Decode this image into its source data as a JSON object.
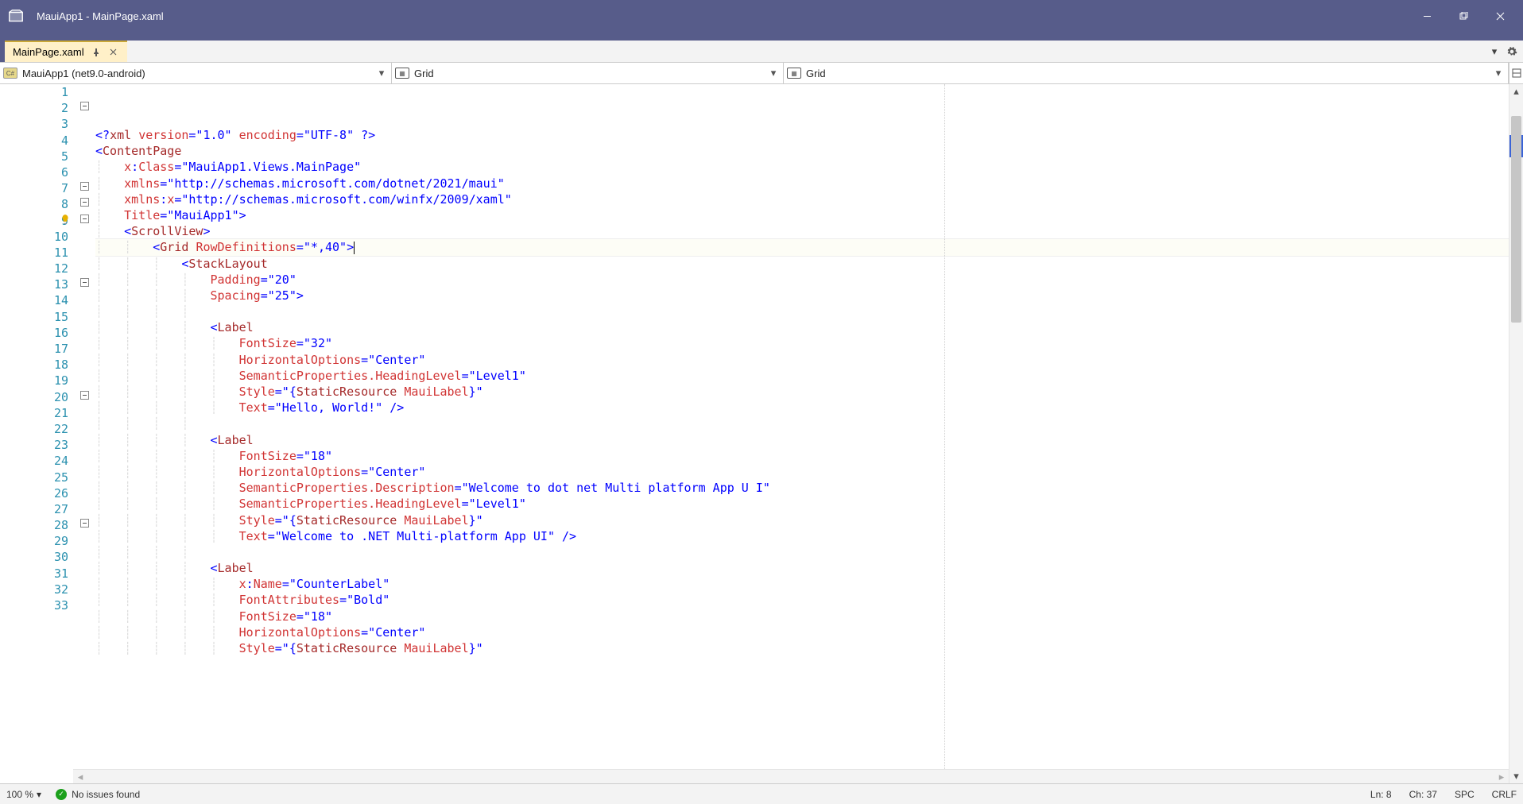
{
  "window": {
    "title": "MauiApp1 - MainPage.xaml"
  },
  "tab": {
    "name": "MainPage.xaml"
  },
  "nav": {
    "project": "MauiApp1 (net9.0-android)",
    "scope": "Grid",
    "element": "Grid"
  },
  "code": {
    "lines": [
      {
        "n": 1,
        "fold": "",
        "ind": 0,
        "segs": [
          {
            "c": "t-blue",
            "t": "<?"
          },
          {
            "c": "t-brown",
            "t": "xml "
          },
          {
            "c": "t-red",
            "t": "version"
          },
          {
            "c": "t-blue",
            "t": "=\"1.0\" "
          },
          {
            "c": "t-red",
            "t": "encoding"
          },
          {
            "c": "t-blue",
            "t": "=\"UTF-8\" ?>"
          }
        ]
      },
      {
        "n": 2,
        "fold": "m",
        "ind": 0,
        "segs": [
          {
            "c": "t-blue",
            "t": "<"
          },
          {
            "c": "t-brown",
            "t": "ContentPage"
          }
        ],
        "hlTag": true
      },
      {
        "n": 3,
        "fold": "",
        "ind": 1,
        "segs": [
          {
            "c": "t-red",
            "t": "x"
          },
          {
            "c": "t-blue",
            "t": ":"
          },
          {
            "c": "t-red",
            "t": "Class"
          },
          {
            "c": "t-blue",
            "t": "=\"MauiApp1.Views.MainPage\""
          }
        ]
      },
      {
        "n": 4,
        "fold": "",
        "ind": 1,
        "segs": [
          {
            "c": "t-red",
            "t": "xmlns"
          },
          {
            "c": "t-blue",
            "t": "=\"http://schemas.microsoft.com/dotnet/2021/maui\""
          }
        ]
      },
      {
        "n": 5,
        "fold": "",
        "ind": 1,
        "segs": [
          {
            "c": "t-red",
            "t": "xmlns"
          },
          {
            "c": "t-blue",
            "t": ":"
          },
          {
            "c": "t-red",
            "t": "x"
          },
          {
            "c": "t-blue",
            "t": "=\"http://schemas.microsoft.com/winfx/2009/xaml\""
          }
        ]
      },
      {
        "n": 6,
        "fold": "",
        "ind": 1,
        "segs": [
          {
            "c": "t-red",
            "t": "Title"
          },
          {
            "c": "t-blue",
            "t": "=\"MauiApp1\">"
          }
        ]
      },
      {
        "n": 7,
        "fold": "m",
        "ind": 1,
        "segs": [
          {
            "c": "t-blue",
            "t": "<"
          },
          {
            "c": "t-brown",
            "t": "ScrollView"
          },
          {
            "c": "t-blue",
            "t": ">"
          }
        ]
      },
      {
        "n": 8,
        "fold": "m",
        "ind": 2,
        "current": true,
        "bulb": true,
        "segs": [
          {
            "c": "t-blue",
            "t": "<"
          },
          {
            "c": "t-brown",
            "t": "Grid "
          },
          {
            "c": "t-red",
            "t": "RowDefinitions"
          },
          {
            "c": "t-blue",
            "t": "=\"*,40\">"
          }
        ],
        "cursor": true
      },
      {
        "n": 9,
        "fold": "m",
        "ind": 3,
        "segs": [
          {
            "c": "t-blue",
            "t": "<"
          },
          {
            "c": "t-brown",
            "t": "StackLayout"
          }
        ]
      },
      {
        "n": 10,
        "fold": "",
        "ind": 4,
        "segs": [
          {
            "c": "t-red",
            "t": "Padding"
          },
          {
            "c": "t-blue",
            "t": "=\"20\""
          }
        ]
      },
      {
        "n": 11,
        "fold": "",
        "ind": 4,
        "segs": [
          {
            "c": "t-red",
            "t": "Spacing"
          },
          {
            "c": "t-blue",
            "t": "=\"25\">"
          }
        ]
      },
      {
        "n": 12,
        "fold": "",
        "ind": 4,
        "segs": []
      },
      {
        "n": 13,
        "fold": "m",
        "ind": 4,
        "segs": [
          {
            "c": "t-blue",
            "t": "<"
          },
          {
            "c": "t-brown",
            "t": "Label"
          }
        ]
      },
      {
        "n": 14,
        "fold": "",
        "ind": 5,
        "segs": [
          {
            "c": "t-red",
            "t": "FontSize"
          },
          {
            "c": "t-blue",
            "t": "=\"32\""
          }
        ]
      },
      {
        "n": 15,
        "fold": "",
        "ind": 5,
        "segs": [
          {
            "c": "t-red",
            "t": "HorizontalOptions"
          },
          {
            "c": "t-blue",
            "t": "=\"Center\""
          }
        ]
      },
      {
        "n": 16,
        "fold": "",
        "ind": 5,
        "segs": [
          {
            "c": "t-red",
            "t": "SemanticProperties.HeadingLevel"
          },
          {
            "c": "t-blue",
            "t": "=\"Level1\""
          }
        ]
      },
      {
        "n": 17,
        "fold": "",
        "ind": 5,
        "segs": [
          {
            "c": "t-red",
            "t": "Style"
          },
          {
            "c": "t-blue",
            "t": "=\"{"
          },
          {
            "c": "t-brown",
            "t": "StaticResource "
          },
          {
            "c": "t-red",
            "t": "MauiLabel"
          },
          {
            "c": "t-blue",
            "t": "}\""
          }
        ]
      },
      {
        "n": 18,
        "fold": "",
        "ind": 5,
        "segs": [
          {
            "c": "t-red",
            "t": "Text"
          },
          {
            "c": "t-blue",
            "t": "=\"Hello, World!\" />"
          }
        ]
      },
      {
        "n": 19,
        "fold": "",
        "ind": 4,
        "segs": []
      },
      {
        "n": 20,
        "fold": "m",
        "ind": 4,
        "segs": [
          {
            "c": "t-blue",
            "t": "<"
          },
          {
            "c": "t-brown",
            "t": "Label"
          }
        ]
      },
      {
        "n": 21,
        "fold": "",
        "ind": 5,
        "segs": [
          {
            "c": "t-red",
            "t": "FontSize"
          },
          {
            "c": "t-blue",
            "t": "=\"18\""
          }
        ]
      },
      {
        "n": 22,
        "fold": "",
        "ind": 5,
        "segs": [
          {
            "c": "t-red",
            "t": "HorizontalOptions"
          },
          {
            "c": "t-blue",
            "t": "=\"Center\""
          }
        ]
      },
      {
        "n": 23,
        "fold": "",
        "ind": 5,
        "segs": [
          {
            "c": "t-red",
            "t": "SemanticProperties.Description"
          },
          {
            "c": "t-blue",
            "t": "=\"Welcome to dot net Multi platform App U I\""
          }
        ]
      },
      {
        "n": 24,
        "fold": "",
        "ind": 5,
        "segs": [
          {
            "c": "t-red",
            "t": "SemanticProperties.HeadingLevel"
          },
          {
            "c": "t-blue",
            "t": "=\"Level1\""
          }
        ]
      },
      {
        "n": 25,
        "fold": "",
        "ind": 5,
        "segs": [
          {
            "c": "t-red",
            "t": "Style"
          },
          {
            "c": "t-blue",
            "t": "=\"{"
          },
          {
            "c": "t-brown",
            "t": "StaticResource "
          },
          {
            "c": "t-red",
            "t": "MauiLabel"
          },
          {
            "c": "t-blue",
            "t": "}\""
          }
        ]
      },
      {
        "n": 26,
        "fold": "",
        "ind": 5,
        "segs": [
          {
            "c": "t-red",
            "t": "Text"
          },
          {
            "c": "t-blue",
            "t": "=\"Welcome to .NET Multi-platform App UI\" />"
          }
        ]
      },
      {
        "n": 27,
        "fold": "",
        "ind": 4,
        "segs": []
      },
      {
        "n": 28,
        "fold": "m",
        "ind": 4,
        "segs": [
          {
            "c": "t-blue",
            "t": "<"
          },
          {
            "c": "t-brown",
            "t": "Label"
          }
        ]
      },
      {
        "n": 29,
        "fold": "",
        "ind": 5,
        "segs": [
          {
            "c": "t-red",
            "t": "x"
          },
          {
            "c": "t-blue",
            "t": ":"
          },
          {
            "c": "t-red",
            "t": "Name"
          },
          {
            "c": "t-blue",
            "t": "=\"CounterLabel\""
          }
        ]
      },
      {
        "n": 30,
        "fold": "",
        "ind": 5,
        "segs": [
          {
            "c": "t-red",
            "t": "FontAttributes"
          },
          {
            "c": "t-blue",
            "t": "=\"Bold\""
          }
        ]
      },
      {
        "n": 31,
        "fold": "",
        "ind": 5,
        "segs": [
          {
            "c": "t-red",
            "t": "FontSize"
          },
          {
            "c": "t-blue",
            "t": "=\"18\""
          }
        ]
      },
      {
        "n": 32,
        "fold": "",
        "ind": 5,
        "segs": [
          {
            "c": "t-red",
            "t": "HorizontalOptions"
          },
          {
            "c": "t-blue",
            "t": "=\"Center\""
          }
        ]
      },
      {
        "n": 33,
        "fold": "",
        "ind": 5,
        "segs": [
          {
            "c": "t-red",
            "t": "Style"
          },
          {
            "c": "t-blue",
            "t": "=\"{"
          },
          {
            "c": "t-brown",
            "t": "StaticResource "
          },
          {
            "c": "t-red",
            "t": "MauiLabel"
          },
          {
            "c": "t-blue",
            "t": "}\""
          }
        ]
      }
    ]
  },
  "status": {
    "zoom": "100 %",
    "issues": "No issues found",
    "line": "Ln: 8",
    "col": "Ch: 37",
    "ins": "SPC",
    "eol": "CRLF"
  }
}
